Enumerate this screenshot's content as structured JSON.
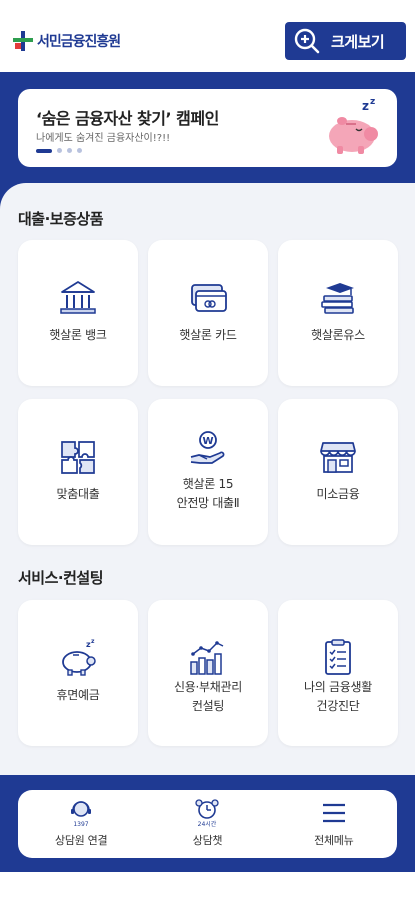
{
  "header": {
    "logo_text": "서민금융진흥원",
    "zoom_label": "크게보기"
  },
  "banner": {
    "title": "‘숨은 금융자산 찾기’ 캠페인",
    "subtitle": "나에게도 숨겨진 금융자산이!?!!"
  },
  "sections": [
    {
      "title": "대출·보증상품",
      "items": [
        {
          "label": "햇살론 뱅크",
          "icon": "bank-icon"
        },
        {
          "label": "햇살론 카드",
          "icon": "credit-card-icon"
        },
        {
          "label": "햇살론유스",
          "icon": "graduation-books-icon"
        },
        {
          "label": "맞춤대출",
          "icon": "puzzle-icon"
        },
        {
          "label": "햇살론 15\n안전망 대출Ⅱ",
          "icon": "hand-coin-icon"
        },
        {
          "label": "미소금융",
          "icon": "storefront-icon"
        }
      ]
    },
    {
      "title": "서비스·컨설팅",
      "items": [
        {
          "label": "휴면예금",
          "icon": "sleeping-piggy-icon"
        },
        {
          "label": "신용·부채관리\n컨설팅",
          "icon": "bar-chart-icon"
        },
        {
          "label": "나의 금융생활\n건강진단",
          "icon": "checklist-icon"
        }
      ]
    }
  ],
  "bottom_nav": [
    {
      "label": "상담원 연결",
      "icon": "headset-icon",
      "badge": "1397"
    },
    {
      "label": "상담챗",
      "icon": "alarm-clock-icon",
      "badge": "24시간"
    },
    {
      "label": "전체메뉴",
      "icon": "hamburger-menu-icon"
    }
  ],
  "colors": {
    "primary": "#1f3a93",
    "background": "#f1f3f8",
    "card": "#ffffff",
    "accent_pink": "#f4a6b8"
  }
}
